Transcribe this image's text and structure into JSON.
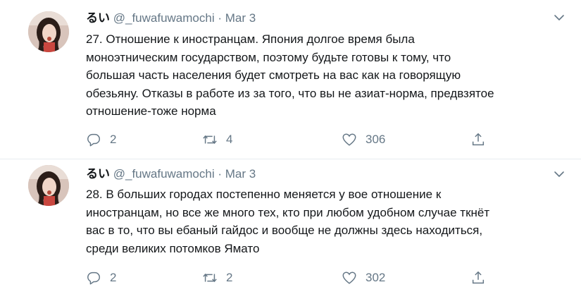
{
  "tweets": [
    {
      "name": "るい",
      "handle": "@_fuwafuwamochi",
      "dot": "·",
      "date": "Mar 3",
      "text": "27. Отношение к иностранцам. Япония долгое время была\nмоноэтническим государством, поэтому будьте готовы к тому, что\nбольшая часть населения будет смотреть на вас как на говорящую\nобезьяну. Отказы в работе из за того, что вы не азиат-норма, предвзятое\nотношение-тоже норма",
      "replies": "2",
      "retweets": "4",
      "likes": "306"
    },
    {
      "name": "るい",
      "handle": "@_fuwafuwamochi",
      "dot": "·",
      "date": "Mar 3",
      "text": "28. В больших городах постепенно меняется у   вое отношение к\nиностранцам, но все же много тех, кто при любом удобном случае ткнёт\nвас в то, что вы ебаный гайдос и вообще не должны здесь находиться,\nсреди великих потомков Ямато",
      "replies": "2",
      "retweets": "2",
      "likes": "302"
    }
  ],
  "icons": {
    "reply": "reply-icon",
    "retweet": "retweet-icon",
    "like": "heart-icon",
    "share": "share-icon",
    "menu": "chevron-down-icon"
  },
  "colors": {
    "muted": "#657786",
    "text": "#14171a",
    "divider": "#e6ecf0"
  }
}
